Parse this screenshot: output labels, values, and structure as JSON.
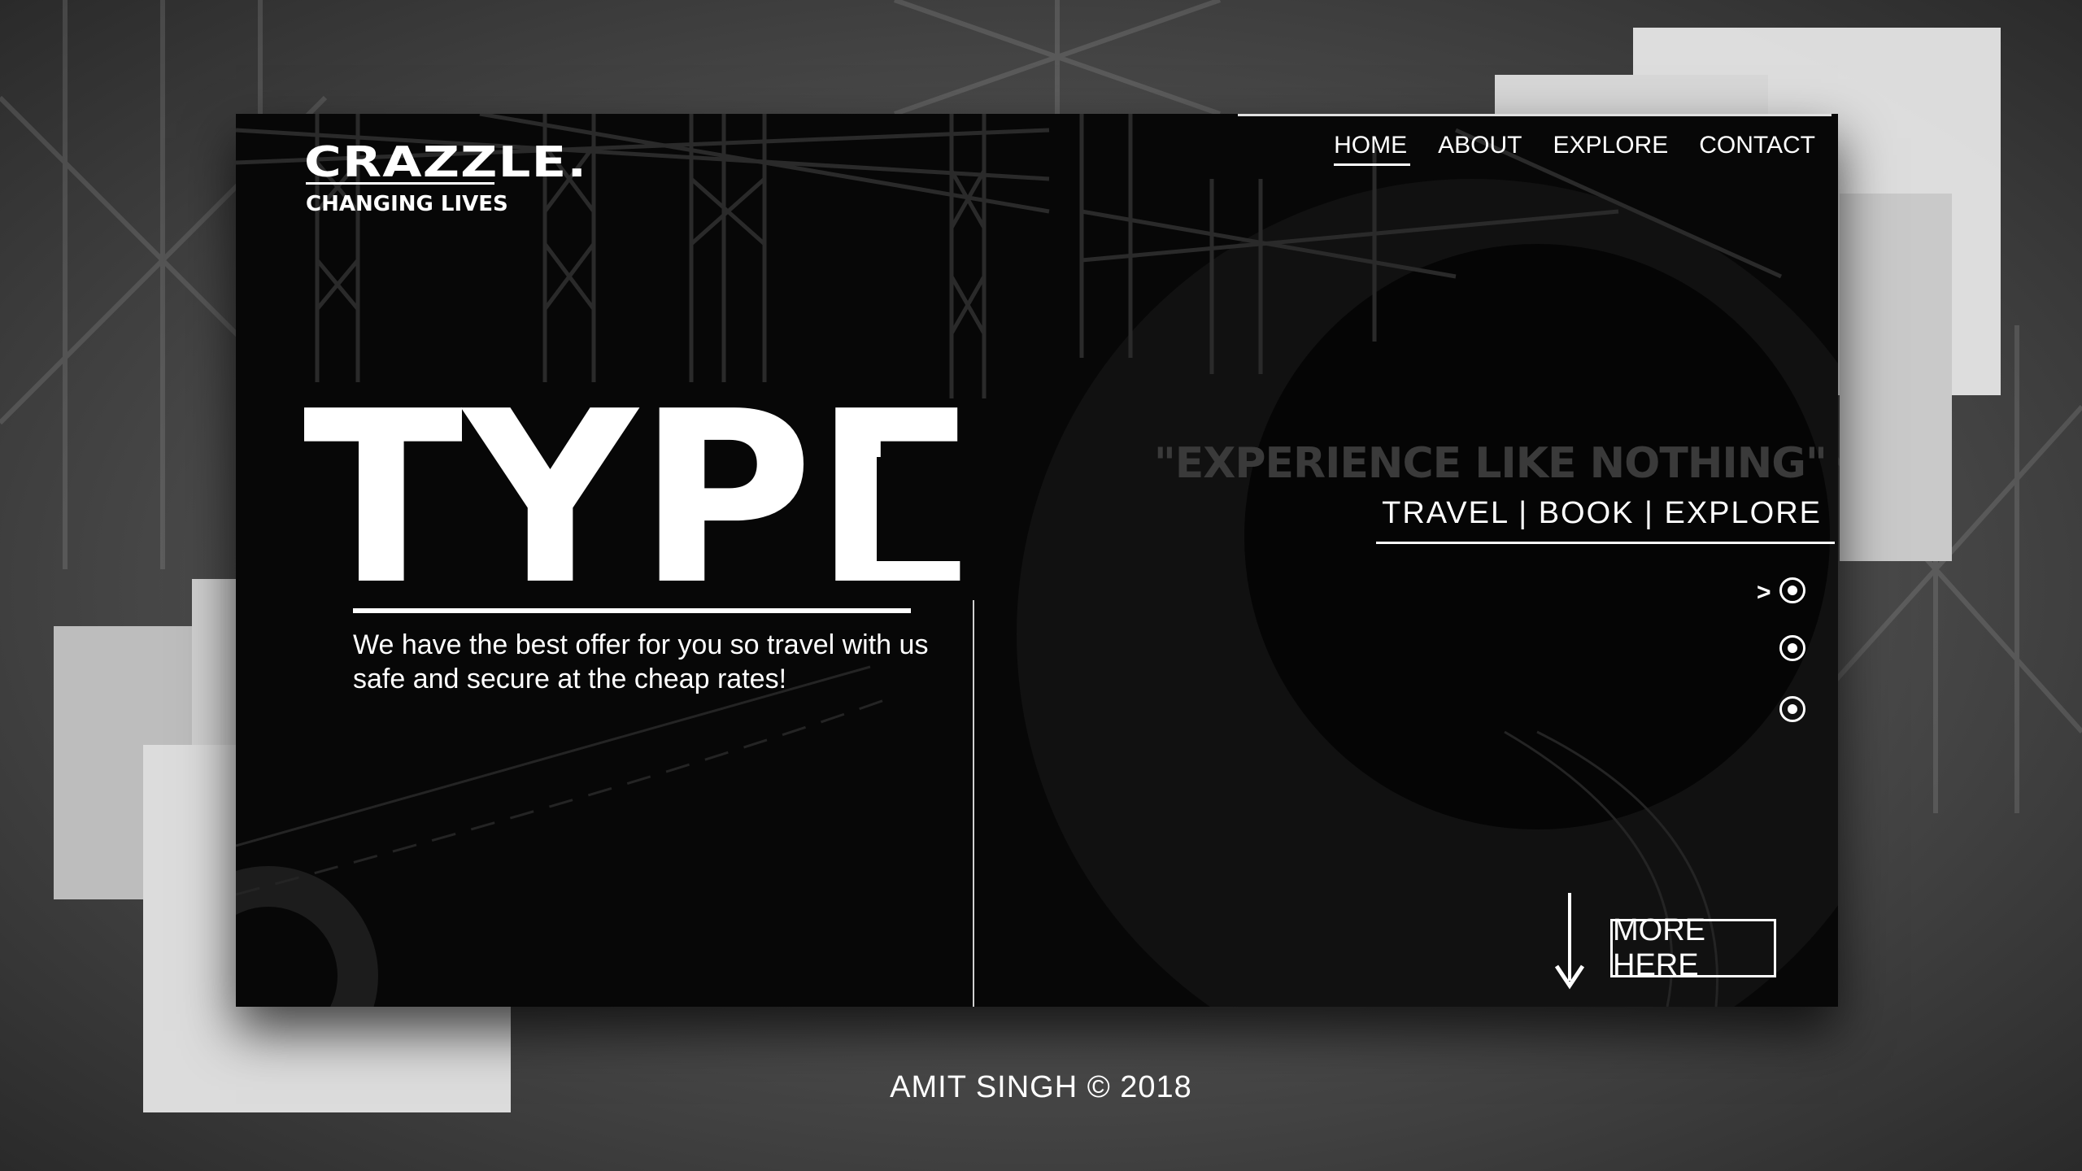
{
  "logo": {
    "name": "CRAZZLE.",
    "tagline": "CHANGING LIVES"
  },
  "nav": {
    "items": [
      {
        "label": "HOME",
        "active": true
      },
      {
        "label": "ABOUT",
        "active": false
      },
      {
        "label": "EXPLORE",
        "active": false
      },
      {
        "label": "CONTACT",
        "active": false
      }
    ]
  },
  "hero": {
    "title": "TYPE",
    "description": "We have the best offer for you so travel with us safe and secure at the cheap rates!"
  },
  "slogan": {
    "quote": "\"EXPERIENCE LIKE NOTHING\"",
    "actions": "TRAVEL | BOOK | EXPLORE"
  },
  "slider": {
    "indicator": ">",
    "dot_count": 3,
    "active_index": 0
  },
  "cta": {
    "label": "MORE HERE"
  },
  "footer": {
    "credit": "AMIT SINGH © 2018"
  },
  "colors": {
    "card": "#070707",
    "accent": "#ffffff",
    "slogan": "#3a3a3a"
  }
}
